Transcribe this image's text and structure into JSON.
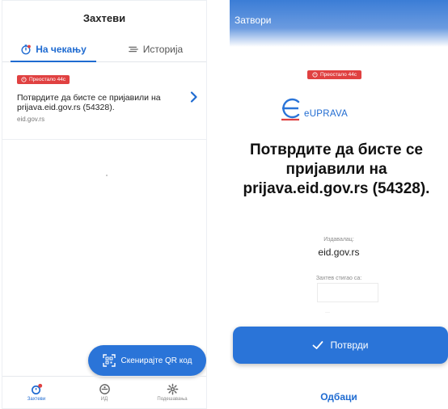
{
  "left": {
    "header": {
      "title": "Захтеви"
    },
    "tabs": [
      {
        "label": "На чекању",
        "active": true,
        "icon": "stopwatch-icon"
      },
      {
        "label": "Историја",
        "active": false,
        "icon": "filter-lines-icon"
      }
    ],
    "request": {
      "badge": "Преостало 44с",
      "title": "Потврдите да бисте се пријавили на prijava.eid.gov.rs (54328).",
      "subtitle": "eid.gov.rs"
    },
    "scan_button": {
      "label": "Скенирајте QR код",
      "icon": "qr-scan-icon"
    },
    "bottom_nav": [
      {
        "label": "Захтеви",
        "icon": "requests-icon",
        "active": true
      },
      {
        "label": "ИД",
        "icon": "id-icon",
        "active": false
      },
      {
        "label": "Подешавања",
        "icon": "gear-icon",
        "active": false
      }
    ]
  },
  "right": {
    "header": {
      "close_label": "Затвори"
    },
    "badge": "Преостало 44с",
    "logo_text": "eUPRAVA",
    "title": "Потврдите да бисте се пријавили на prijava.eid.gov.rs (54328).",
    "issuer": {
      "label": "Издавалац:",
      "value": "eid.gov.rs"
    },
    "from": {
      "label": "Захтев стигао са:"
    },
    "confirm_label": "Потврди",
    "reject_label": "Одбаци"
  },
  "colors": {
    "accent": "#2a74d8",
    "badge": "#e04141"
  }
}
